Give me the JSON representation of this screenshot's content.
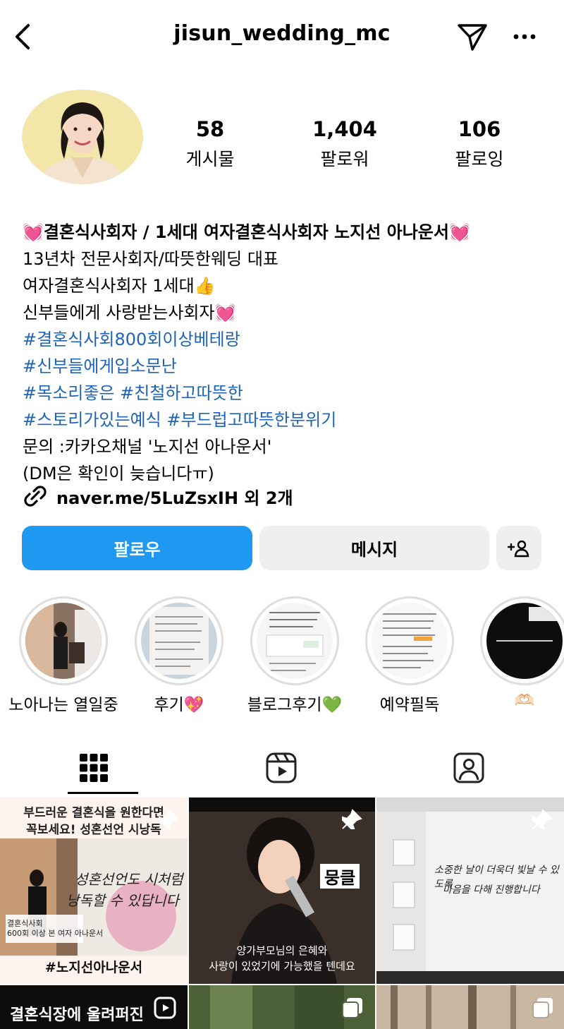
{
  "header": {
    "username": "jisun_wedding_mc"
  },
  "stats": [
    {
      "value": "58",
      "label": "게시물"
    },
    {
      "value": "1,404",
      "label": "팔로워"
    },
    {
      "value": "106",
      "label": "팔로잉"
    }
  ],
  "bio": {
    "name_line": "결혼식사회자 / 1세대 여자결혼식사회자 노지선 아나운서",
    "line1": "13년차 전문사회자/따뜻한웨딩 대표",
    "line2": "여자결혼식사회자 1세대",
    "line3": "신부들에게 사랑받는사회자",
    "tag1": "#결혼식사회800회이상베테랑",
    "tag2": "#신부들에게입소문난",
    "tag3a": "#목소리좋은",
    "tag3b": "#친철하고따뜻한",
    "tag4a": "#스토리가있는예식",
    "tag4b": "#부드럽고따뜻한분위기",
    "contact": "문의 :카카오채널 '노지선 아나운서'",
    "dm_note": "(DM은 확인이 늦습니다ㅠ)",
    "emoji_heart": "💓",
    "emoji_thumb": "👍"
  },
  "link": {
    "text": "naver.me/5LuZsxIH 외 2개"
  },
  "buttons": {
    "follow": "팔로우",
    "message": "메시지",
    "add_user": "+ዩ"
  },
  "highlights": [
    {
      "label": "노아나는 열일중"
    },
    {
      "label": "후기💖"
    },
    {
      "label": "블로그후기💚"
    },
    {
      "label": "예약필독"
    },
    {
      "label": "🫶🏻"
    }
  ],
  "posts": {
    "p1_title1": "부드러운 결혼식을 원한다면",
    "p1_title2": "꼭보세요! 성혼선언 시낭독",
    "p1_script": "성혼선언도 시처럼",
    "p1_script2": "낭독할 수 있답니다",
    "p1_caption1": "결혼식사회",
    "p1_caption2": "600회 이상 본 여자 아나운서",
    "p1_hashtag": "#노지선아나운서",
    "p2_badge": "뭉클",
    "p2_sub1": "양가부모님의 은혜와",
    "p2_sub2": "사랑이 있었기에 가능했을 텐데요",
    "p3_script1": "소중한 날이 더욱더 빛날 수 있도록",
    "p3_script2": "마음을 다해 진행합니다",
    "p4_title": "결혼식장에 울려퍼진"
  }
}
